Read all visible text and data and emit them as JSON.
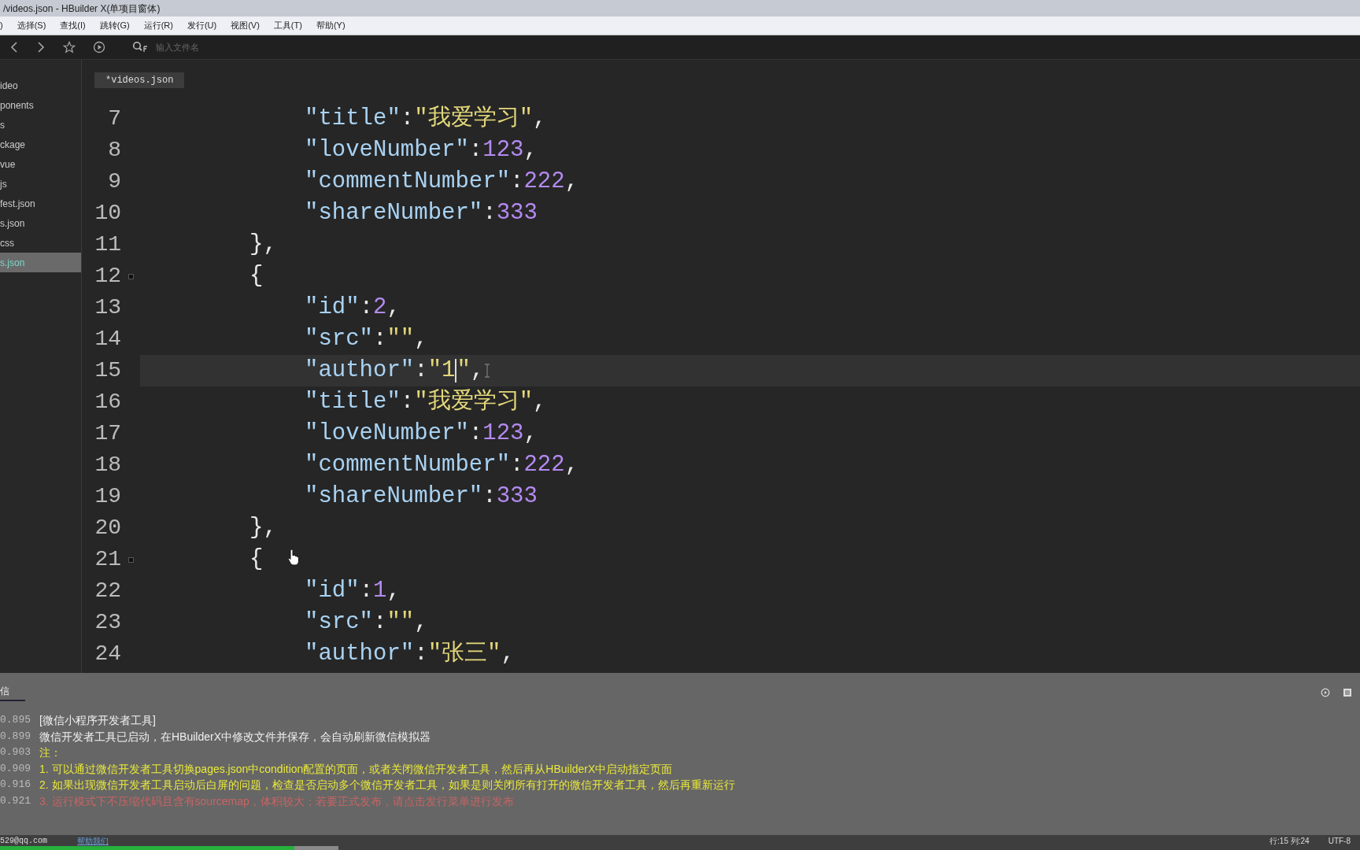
{
  "window": {
    "title": "/videos.json - HBuilder X(单项目窗体)"
  },
  "menu": [
    ")",
    "选择(S)",
    "查找(I)",
    "跳转(G)",
    "运行(R)",
    "发行(U)",
    "视图(V)",
    "工具(T)",
    "帮助(Y)"
  ],
  "toolbar": {
    "placeholder": "输入文件名"
  },
  "sidebar": {
    "items": [
      {
        "label": "ideo",
        "selected": false
      },
      {
        "label": "ponents",
        "selected": false
      },
      {
        "label": "s",
        "selected": false
      },
      {
        "label": "ckage",
        "selected": false
      },
      {
        "label": "vue",
        "selected": false
      },
      {
        "label": "js",
        "selected": false
      },
      {
        "label": "fest.json",
        "selected": false
      },
      {
        "label": "s.json",
        "selected": false
      },
      {
        "label": "css",
        "selected": false
      },
      {
        "label": "s.json",
        "selected": true
      }
    ]
  },
  "tabs": [
    {
      "label": "*videos.json",
      "selected": true
    }
  ],
  "editor": {
    "lines": [
      {
        "number": "7",
        "kind": "member",
        "current": false,
        "fold": false,
        "tokens": [
          {
            "kind": "key",
            "text": "\"title\""
          },
          {
            "kind": "punct",
            "text": ":"
          },
          {
            "kind": "string",
            "text": "\"我爱学习\""
          },
          {
            "kind": "punct",
            "text": ","
          }
        ]
      },
      {
        "number": "8",
        "kind": "member",
        "current": false,
        "fold": false,
        "tokens": [
          {
            "kind": "key",
            "text": "\"loveNumber\""
          },
          {
            "kind": "punct",
            "text": ":"
          },
          {
            "kind": "number",
            "text": "123"
          },
          {
            "kind": "punct",
            "text": ","
          }
        ]
      },
      {
        "number": "9",
        "kind": "member",
        "current": false,
        "fold": false,
        "tokens": [
          {
            "kind": "key",
            "text": "\"commentNumber\""
          },
          {
            "kind": "punct",
            "text": ":"
          },
          {
            "kind": "number",
            "text": "222"
          },
          {
            "kind": "punct",
            "text": ","
          }
        ]
      },
      {
        "number": "10",
        "kind": "member",
        "current": false,
        "fold": false,
        "tokens": [
          {
            "kind": "key",
            "text": "\"shareNumber\""
          },
          {
            "kind": "punct",
            "text": ":"
          },
          {
            "kind": "number",
            "text": "333"
          }
        ]
      },
      {
        "number": "11",
        "kind": "brace",
        "current": false,
        "fold": false,
        "tokens": [
          {
            "kind": "punct",
            "text": "},"
          }
        ]
      },
      {
        "number": "12",
        "kind": "brace",
        "current": false,
        "fold": true,
        "tokens": [
          {
            "kind": "punct",
            "text": "{"
          }
        ]
      },
      {
        "number": "13",
        "kind": "member",
        "current": false,
        "fold": false,
        "tokens": [
          {
            "kind": "key",
            "text": "\"id\""
          },
          {
            "kind": "punct",
            "text": ":"
          },
          {
            "kind": "number",
            "text": "2"
          },
          {
            "kind": "punct",
            "text": ","
          }
        ]
      },
      {
        "number": "14",
        "kind": "member",
        "current": false,
        "fold": false,
        "tokens": [
          {
            "kind": "key",
            "text": "\"src\""
          },
          {
            "kind": "punct",
            "text": ":"
          },
          {
            "kind": "string",
            "text": "\"\""
          },
          {
            "kind": "punct",
            "text": ","
          }
        ]
      },
      {
        "number": "15",
        "kind": "member",
        "current": true,
        "fold": false,
        "tokens": [
          {
            "kind": "key",
            "text": "\"author\""
          },
          {
            "kind": "punct",
            "text": ":"
          },
          {
            "kind": "string",
            "text": "\"1",
            "caret": true
          },
          {
            "kind": "string",
            "text": "\""
          },
          {
            "kind": "punct",
            "text": ","
          }
        ]
      },
      {
        "number": "16",
        "kind": "member",
        "current": false,
        "fold": false,
        "tokens": [
          {
            "kind": "key",
            "text": "\"title\""
          },
          {
            "kind": "punct",
            "text": ":"
          },
          {
            "kind": "string",
            "text": "\"我爱学习\""
          },
          {
            "kind": "punct",
            "text": ","
          }
        ]
      },
      {
        "number": "17",
        "kind": "member",
        "current": false,
        "fold": false,
        "tokens": [
          {
            "kind": "key",
            "text": "\"loveNumber\""
          },
          {
            "kind": "punct",
            "text": ":"
          },
          {
            "kind": "number",
            "text": "123"
          },
          {
            "kind": "punct",
            "text": ","
          }
        ]
      },
      {
        "number": "18",
        "kind": "member",
        "current": false,
        "fold": false,
        "tokens": [
          {
            "kind": "key",
            "text": "\"commentNumber\""
          },
          {
            "kind": "punct",
            "text": ":"
          },
          {
            "kind": "number",
            "text": "222"
          },
          {
            "kind": "punct",
            "text": ","
          }
        ]
      },
      {
        "number": "19",
        "kind": "member",
        "current": false,
        "fold": false,
        "tokens": [
          {
            "kind": "key",
            "text": "\"shareNumber\""
          },
          {
            "kind": "punct",
            "text": ":"
          },
          {
            "kind": "number",
            "text": "333"
          }
        ]
      },
      {
        "number": "20",
        "kind": "brace",
        "current": false,
        "fold": false,
        "tokens": [
          {
            "kind": "punct",
            "text": "},"
          }
        ]
      },
      {
        "number": "21",
        "kind": "brace",
        "current": false,
        "fold": true,
        "tokens": [
          {
            "kind": "punct",
            "text": "{"
          }
        ]
      },
      {
        "number": "22",
        "kind": "member",
        "current": false,
        "fold": false,
        "tokens": [
          {
            "kind": "key",
            "text": "\"id\""
          },
          {
            "kind": "punct",
            "text": ":"
          },
          {
            "kind": "number",
            "text": "1"
          },
          {
            "kind": "punct",
            "text": ","
          }
        ]
      },
      {
        "number": "23",
        "kind": "member",
        "current": false,
        "fold": false,
        "tokens": [
          {
            "kind": "key",
            "text": "\"src\""
          },
          {
            "kind": "punct",
            "text": ":"
          },
          {
            "kind": "string",
            "text": "\"\""
          },
          {
            "kind": "punct",
            "text": ","
          }
        ]
      },
      {
        "number": "24",
        "kind": "member",
        "current": false,
        "fold": false,
        "tokens": [
          {
            "kind": "key",
            "text": "\"author\""
          },
          {
            "kind": "punct",
            "text": ":"
          },
          {
            "kind": "string",
            "text": "\"张三\""
          },
          {
            "kind": "punct",
            "text": ","
          }
        ]
      }
    ]
  },
  "console": {
    "tab": "信",
    "lines": [
      {
        "time": "0.895",
        "color": "#f0f0f0",
        "text": "[微信小程序开发者工具]"
      },
      {
        "time": "0.899",
        "color": "#f0f0f0",
        "text": "微信开发者工具已启动，在HBuilderX中修改文件并保存，会自动刷新微信模拟器"
      },
      {
        "time": "0.903",
        "color": "#e8e83a",
        "text": "注："
      },
      {
        "time": "0.909",
        "color": "#e8e83a",
        "text": "1. 可以通过微信开发者工具切换pages.json中condition配置的页面，或者关闭微信开发者工具，然后再从HBuilderX中启动指定页面"
      },
      {
        "time": "0.916",
        "color": "#e8e83a",
        "text": "2. 如果出现微信开发者工具启动后白屏的问题，检查是否启动多个微信开发者工具，如果是则关闭所有打开的微信开发者工具，然后再重新运行"
      },
      {
        "time": "0.921",
        "color": "#c86464",
        "text": "3. 运行模式下不压缩代码且含有sourcemap，体积较大；若要正式发布，请点击发行菜单进行发布"
      }
    ]
  },
  "status_bar": {
    "account": "529@qq.com",
    "link": "帮助我们",
    "position": "行:15  列:24",
    "encoding": "UTF-8",
    "progress": {
      "level": 0.87
    }
  }
}
